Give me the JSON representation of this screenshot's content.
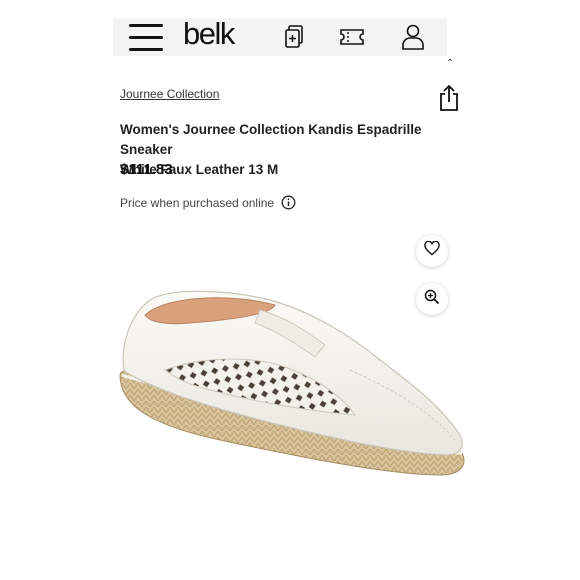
{
  "header": {
    "logo": "belk",
    "icons": [
      "menu-icon",
      "list-icon",
      "ticket-icon",
      "account-icon"
    ]
  },
  "product": {
    "brand": "Journee Collection",
    "title_line1": "Women's Journee Collection Kandis Espadrille Sneaker",
    "title_line2": "White Faux Leather 13 M",
    "price": "$111.83",
    "price_note": "Price when purchased online"
  },
  "actions": {
    "icons": [
      "share-icon",
      "info-icon",
      "heart-icon",
      "zoom-in-icon"
    ]
  },
  "image": {
    "alt": "White faux leather perforated slip-on espadrille sneaker with jute rope sole"
  }
}
